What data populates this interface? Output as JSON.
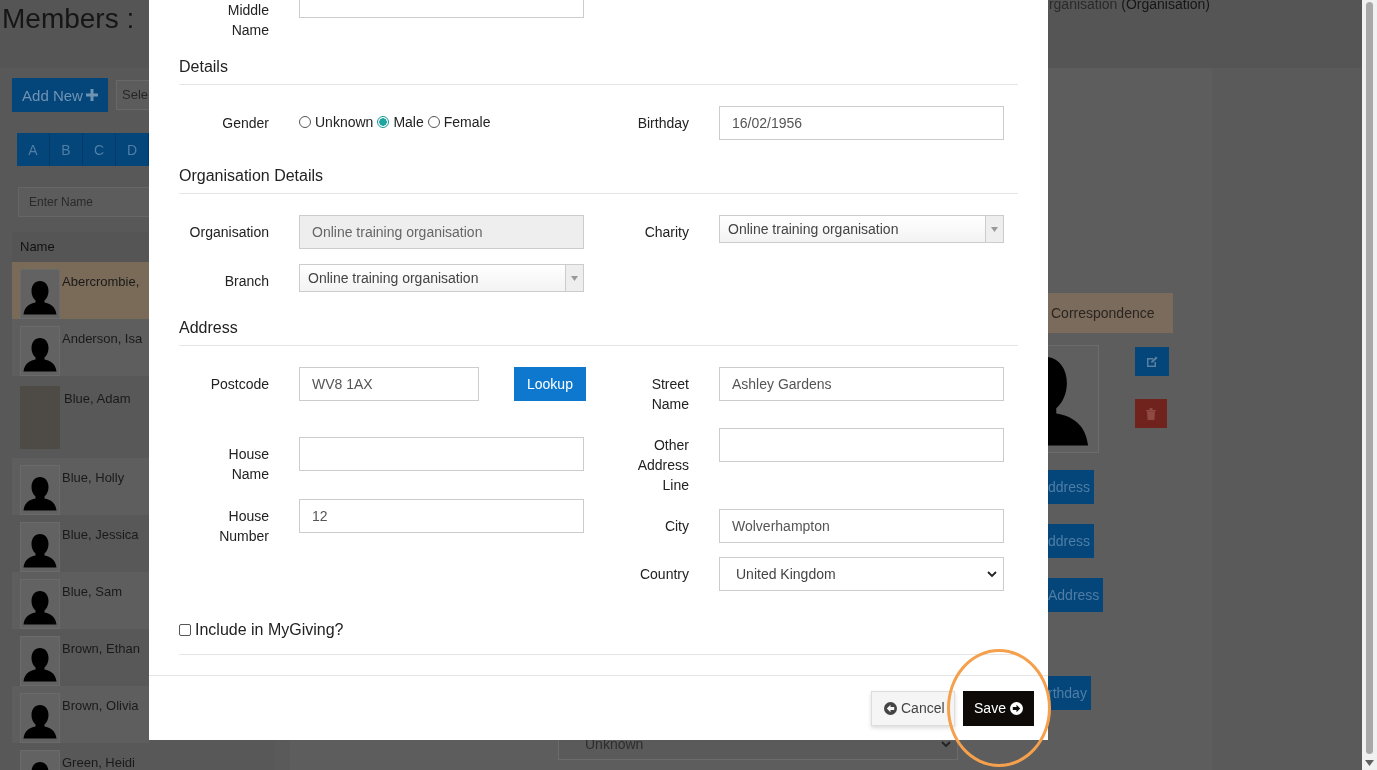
{
  "page": {
    "title": "Members :",
    "context_link": "rganisation",
    "context_type": "(Organisation)"
  },
  "toolbar": {
    "add_button": "Add New",
    "select_text": "Sele"
  },
  "alphabet": [
    "A",
    "B",
    "C",
    "D"
  ],
  "name_filter": {
    "placeholder": "Enter Name"
  },
  "list_header": "Name",
  "members": [
    {
      "name": "Abercrombie,",
      "kind": "silhouette",
      "selected": true
    },
    {
      "name": "Anderson, Isa",
      "kind": "silhouette",
      "selected": false
    },
    {
      "name": "Blue, Adam",
      "kind": "photo",
      "selected": false
    },
    {
      "name": "Blue, Holly",
      "kind": "silhouette",
      "selected": false
    },
    {
      "name": "Blue, Jessica",
      "kind": "silhouette",
      "selected": false
    },
    {
      "name": "Blue, Sam",
      "kind": "silhouette",
      "selected": false
    },
    {
      "name": "Brown, Ethan",
      "kind": "silhouette",
      "selected": false
    },
    {
      "name": "Brown, Olivia",
      "kind": "silhouette",
      "selected": false
    },
    {
      "name": "Green, Heidi",
      "kind": "silhouette",
      "selected": false
    }
  ],
  "detail": {
    "tab": "Correspondence",
    "buttons": [
      "ddress",
      "ddress",
      "Address",
      "rthday"
    ],
    "select_value": "Unknown"
  },
  "modal": {
    "top_fields": [
      {
        "kind": "text",
        "label": "Middle Name",
        "disabled": false
      }
    ],
    "sections": [
      {
        "title": "Details",
        "left": [
          {
            "kind": "radio",
            "label": "Gender",
            "options": [
              {
                "label": "Unknown",
                "selected": false
              },
              {
                "label": "Male",
                "selected": true
              },
              {
                "label": "Female",
                "selected": false
              }
            ]
          }
        ],
        "right": [
          {
            "kind": "text",
            "label": "Birthday",
            "value": "16/02/1956",
            "disabled": false
          }
        ]
      },
      {
        "title": "Organisation Details",
        "left": [
          {
            "kind": "text",
            "label": "Organisation",
            "value": "Online training organisation",
            "disabled": true
          },
          {
            "kind": "combo",
            "label": "Branch",
            "value": "Online training organisation",
            "disabled": false
          }
        ],
        "right": [
          {
            "kind": "combo",
            "label": "Charity",
            "value": "Online training organisation",
            "disabled": false
          }
        ]
      },
      {
        "title": "Address",
        "left": [
          {
            "kind": "lookup",
            "label": "Postcode",
            "value": "WV8 1AX",
            "button": "Lookup",
            "disabled": false
          },
          {
            "kind": "text",
            "label": "House Name",
            "disabled": false
          },
          {
            "kind": "text",
            "label": "House Number",
            "value": "12",
            "disabled": false
          }
        ],
        "right": [
          {
            "kind": "text",
            "label": "Street Name",
            "value": "Ashley Gardens",
            "disabled": false
          },
          {
            "kind": "text",
            "label": "Other Address Line",
            "disabled": false
          },
          {
            "kind": "text",
            "label": "City",
            "value": "Wolverhampton",
            "disabled": false
          },
          {
            "kind": "select",
            "label": "Country",
            "value": "United Kingdom",
            "disabled": false
          }
        ]
      }
    ],
    "checkbox": {
      "label": "Include in MyGiving?",
      "checked": false
    },
    "buttons": [
      {
        "kind": "cancel",
        "label": "Cancel",
        "highlighted": false
      },
      {
        "kind": "save",
        "label": "Save",
        "highlighted": true
      }
    ]
  }
}
